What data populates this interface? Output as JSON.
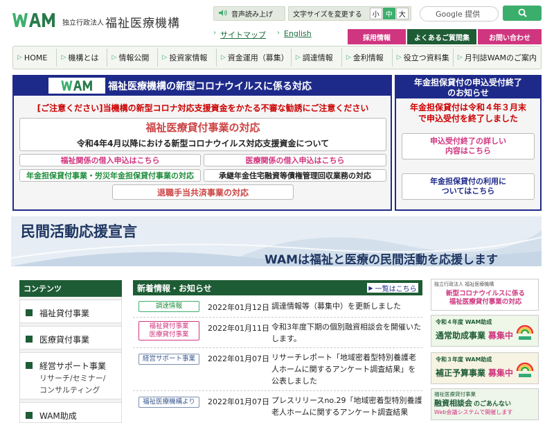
{
  "header": {
    "logo_text": "WAM",
    "org_prefix": "独立行政法人",
    "org_name": "福祉医療機構",
    "audio_label": "音声読み上げ",
    "fontsize_label": "文字サイズを変更する",
    "fontsize_options": [
      "小",
      "中",
      "大"
    ],
    "fontsize_selected": "中",
    "search_placeholder": "Google 提供",
    "sitemap_label": "サイトマップ",
    "english_label": "English",
    "tabs": [
      "採用情報",
      "よくあるご質問集",
      "お問い合わせ"
    ]
  },
  "nav": {
    "items": [
      "HOME",
      "機構とは",
      "情報公開",
      "投資家情報",
      "資金運用（募集）",
      "調達情報",
      "金利情報",
      "役立つ資料集",
      "月刊誌WAMのご案内"
    ]
  },
  "covid": {
    "title": "福祉医療機構の新型コロナウイルスに係る対応",
    "notice": "[ご注意ください]当機構の新型コロナ対応支援資金をかたる不審な勧誘にご注意ください",
    "welfare_loan_title": "福祉医療貸付事業の対応",
    "welfare_loan_sub": "令和4年4月以降における新型コロナウイルス対応支援資金について",
    "welfare_apply": "福祉関係の借入申込はこちら",
    "medical_apply": "医療関係の借入申込はこちら",
    "pension": "年金担保貸付事業・労災年金担保貸付事業の対応",
    "shonen": "承継年金住宅融資等債権管理回収業務の対応",
    "retire": "退職手当共済事業の対応"
  },
  "pension_end": {
    "title_line1": "年金担保貸付の申込受付終了",
    "title_line2": "のお知らせ",
    "note_line1": "年金担保貸付は令和４年３月末",
    "note_line2": "で申込受付を終了しました",
    "btn1_line1": "申込受付終了の詳しい",
    "btn1_line2": "内容はこちら",
    "btn2_line1": "年金担保貸付の利用に",
    "btn2_line2": "ついてはこちら"
  },
  "banner": {
    "title": "民間活動応援宣言",
    "subtitle": "WAMは福祉と医療の民間活動を応援します"
  },
  "sidebar": {
    "title": "コンテンツ",
    "items": [
      {
        "label": "福祉貸付事業"
      },
      {
        "label": "医療貸付事業"
      },
      {
        "label": "経営サポート事業",
        "sub1": "リサーチ/セミナー/",
        "sub2": "コンサルティング"
      },
      {
        "label": "WAM助成"
      }
    ]
  },
  "news": {
    "title": "新着情報・お知らせ",
    "more_label": "一覧はこちら",
    "items": [
      {
        "tag": "調達情報",
        "tag2": "",
        "date": "2022年01月12日",
        "text": "調達情報等（募集中）を更新しました"
      },
      {
        "tag": "福祉貸付事業",
        "tag2": "医療貸付事業",
        "date": "2022年01月11日",
        "text": "令和3年度下期の個別融資相談会を開催いたします。"
      },
      {
        "tag": "経営サポート事業",
        "tag2": "",
        "date": "2022年01月07日",
        "text": "リサーチレポート「地域密着型特別養護老人ホームに関するアンケート調査結果」を公表しました"
      },
      {
        "tag": "福祉医療機構より",
        "tag2": "",
        "date": "2022年01月07日",
        "text": "プレスリリースno.29「地域密着型特別養護老人ホームに関するアンケート調査結果"
      }
    ]
  },
  "right_banners": {
    "b1_small": "独立行政法人 福祉医療機構",
    "b1_line1": "新型コロナウイルスに係る",
    "b1_line2": "福祉医療貸付事業の対応",
    "b2_small": "令和４年度 WAM助成",
    "b2_main": "通常助成事業",
    "b2_accent": "募集中",
    "b3_small": "令和３年度 WAM助成",
    "b3_main": "補正予算事業",
    "b3_accent": "募集中",
    "b4_small": "福祉医療貸付事業",
    "b4_main": "融資相談会",
    "b4_tail": "のごあんない",
    "b4_note": "Web会議システムで開催します"
  },
  "colors": {
    "brand_green": "#1e5c35",
    "accent_green": "#3cae6c",
    "pink": "#d0357f",
    "navy": "#1e2a8a"
  }
}
